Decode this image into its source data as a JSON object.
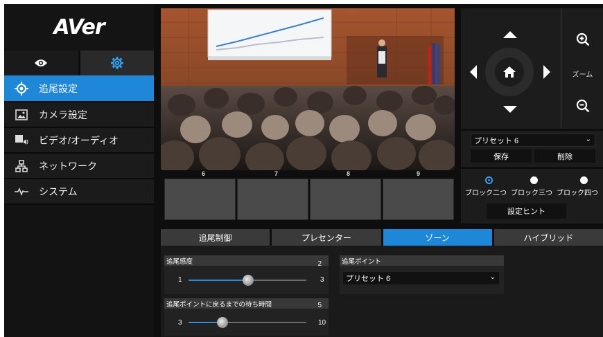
{
  "brand": {
    "logo_text": "AVer"
  },
  "view_tabs": [
    {
      "icon": "eye-icon"
    },
    {
      "icon": "gear-icon",
      "active": true
    }
  ],
  "menu": [
    {
      "label": "追尾設定",
      "icon": "target-icon",
      "active": true
    },
    {
      "label": "カメラ設定",
      "icon": "image-icon"
    },
    {
      "label": "ビデオ/オーディオ",
      "icon": "video-audio-icon"
    },
    {
      "label": "ネットワーク",
      "icon": "network-icon"
    },
    {
      "label": "システム",
      "icon": "pulse-icon"
    }
  ],
  "video": {
    "thumb_labels": [
      "6",
      "7",
      "8",
      "9"
    ]
  },
  "ptz": {
    "zoom_label": "ズーム"
  },
  "preset": {
    "selected": "プリセット 6",
    "save_label": "保存",
    "delete_label": "削除"
  },
  "blocks": {
    "options": [
      "ブロック二つ",
      "ブロック三つ",
      "ブロック四つ"
    ],
    "selected_index": 0,
    "hint_label": "設定ヒント"
  },
  "mode_tabs": [
    {
      "label": "追尾制御"
    },
    {
      "label": "プレセンター"
    },
    {
      "label": "ゾーン",
      "active": true
    },
    {
      "label": "ハイブリッド"
    }
  ],
  "sensitivity": {
    "title": "追尾感度",
    "value": "2",
    "min": "1",
    "max": "3"
  },
  "wait_time": {
    "title": "追尾ポイントに戻るまでの待ち時間",
    "value": "5",
    "min": "3",
    "max": "10"
  },
  "tracking_point": {
    "title": "追尾ポイント",
    "selected": "プリセット 6"
  },
  "colors": {
    "accent": "#1f87d7",
    "background": "#0e0e0e",
    "panel": "#1c1c1c"
  }
}
